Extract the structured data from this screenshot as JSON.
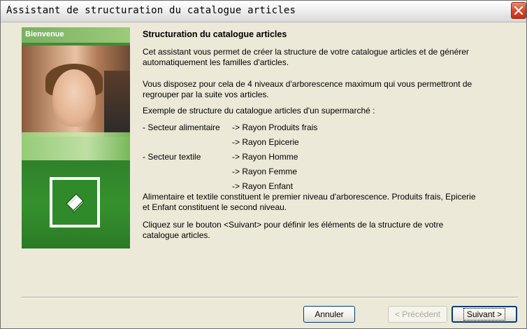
{
  "window": {
    "title": "Assistant de structuration du catalogue articles"
  },
  "banner": {
    "label": "Bienvenue",
    "icon": "document-icon"
  },
  "main": {
    "heading": "Structuration du catalogue articles",
    "p1_line1": "Cet assistant vous permet de créer la structure de votre catalogue articles et de générer",
    "p1_line2": "automatiquement les familles d'articles.",
    "p2_line1": "Vous disposez pour cela de 4 niveaux d'arborescence maximum qui vous permettront de",
    "p2_line2": "regrouper par la suite vos articles.",
    "p3": "Exemple de structure du catalogue articles d'un supermarché :",
    "tree": [
      {
        "left": "- Secteur alimentaire",
        "right": "-> Rayon Produits frais"
      },
      {
        "left": "",
        "right": "-> Rayon Epicerie"
      },
      {
        "left": "- Secteur textile",
        "right": "-> Rayon Homme"
      },
      {
        "left": "",
        "right": "-> Rayon Femme"
      },
      {
        "left": "",
        "right": "-> Rayon Enfant"
      }
    ],
    "p4_line1": "Alimentaire et textile constituent le premier niveau d'arborescence. Produits frais, Epicerie",
    "p4_line2": "et Enfant constituent le second niveau.",
    "p5_line1": "Cliquez sur le bouton  <Suivant> pour définir les éléments de la structure de votre",
    "p5_line2": "catalogue articles."
  },
  "buttons": {
    "cancel": "Annuler",
    "previous": "< Précédent",
    "next": "Suivant >"
  },
  "colors": {
    "close_button": "#d9472b",
    "accent_green": "#3a7f31"
  }
}
